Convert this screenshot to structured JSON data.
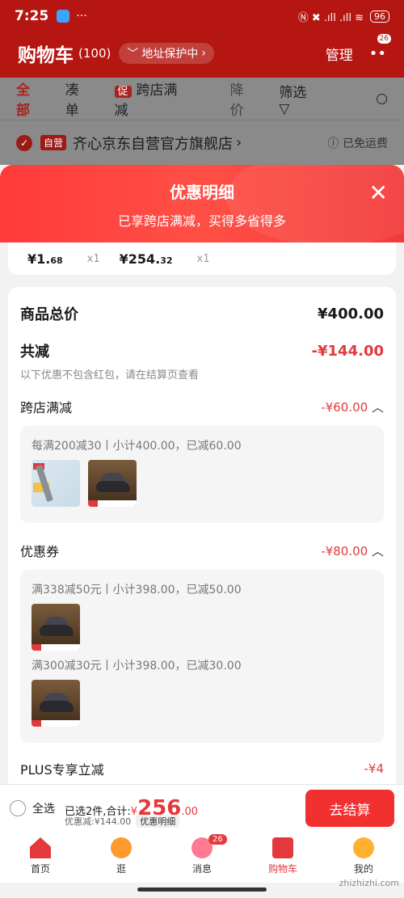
{
  "status_bar": {
    "time": "7:25",
    "dots": "···",
    "signal": "Ⓝ ✖ .ıll .ıll ≋",
    "battery": "96"
  },
  "header": {
    "title": "购物车",
    "count": "(100)",
    "address_pill": "地址保护中",
    "manage": "管理",
    "more": "••",
    "more_badge": "26"
  },
  "tabs": {
    "all": "全部",
    "bundle": "凑单",
    "promo_tag": "促",
    "cross_store": "跨店满减",
    "price_drop": "降价",
    "filter": "筛选"
  },
  "store": {
    "tag": "自营",
    "name": "齐心京东自营官方旗舰店",
    "shipping": "已免运费"
  },
  "modal": {
    "title": "优惠明细",
    "subtitle": "已享跨店满减，买得多省得多",
    "prev_items": [
      {
        "price_int": "¥1.",
        "price_dec": "68",
        "qty": "x1"
      },
      {
        "price_int": "¥254.",
        "price_dec": "32",
        "qty": "x1"
      }
    ],
    "total_label": "商品总价",
    "total_value": "¥400.00",
    "reduce_label": "共减",
    "reduce_value": "-¥144.00",
    "reduce_note": "以下优惠不包含红包，请在结算页查看",
    "cross_label": "跨店满减",
    "cross_value": "-¥60.00",
    "cross_rule": "每满200减30丨小计400.00，已减60.00",
    "coupon_label": "优惠券",
    "coupon_value": "-¥80.00",
    "coupon_rule1": "满338减50元丨小计398.00，已减50.00",
    "coupon_rule2": "满300减30元丨小计398.00，已减30.00",
    "plus_label": "PLUS专享立减",
    "plus_value": "-¥4"
  },
  "checkout": {
    "select_all": "全选",
    "selected_text": "已选2件,合计:",
    "currency": "¥",
    "amount_int": "256",
    "amount_dec": ".00",
    "discount_text": "优惠减:¥144.00",
    "detail_button": "优惠明细",
    "pay_button": "去结算"
  },
  "nav": [
    {
      "label": "首页"
    },
    {
      "label": "逛"
    },
    {
      "label": "消息",
      "badge": "26"
    },
    {
      "label": "购物车"
    },
    {
      "label": "我的"
    }
  ],
  "watermark": "zhizhizhi.com",
  "colors": {
    "brand_red": "#e4393c",
    "header_red": "#b51612",
    "pay_button": "#f23030"
  }
}
